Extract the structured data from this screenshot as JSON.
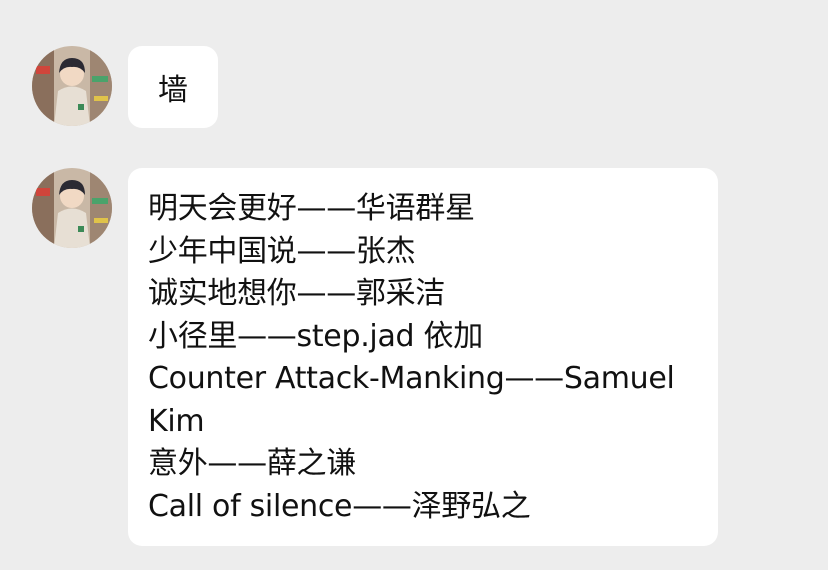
{
  "messages": [
    {
      "sender_avatar": "profile-avatar-illustration",
      "text": "墙"
    },
    {
      "sender_avatar": "profile-avatar-illustration",
      "lines": [
        "明天会更好——华语群星",
        "少年中国说——张杰",
        "诚实地想你——郭采洁",
        "小径里——step.jad 依加",
        "Counter Attack-Manking——Samuel",
        "Kim",
        "意外——薛之谦",
        "Call of silence——泽野弘之"
      ]
    }
  ],
  "colors": {
    "background": "#ededed",
    "bubble": "#ffffff",
    "text": "#111111"
  }
}
